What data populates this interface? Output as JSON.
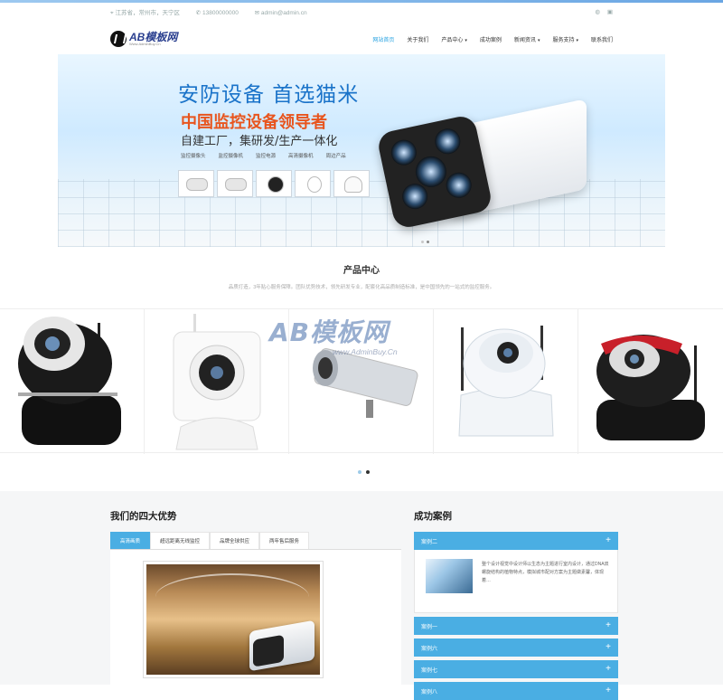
{
  "topbar": {
    "location": "江苏省，常州市，天宁区",
    "phone": "13800000000",
    "email": "admin@admin.cn",
    "icons": [
      "location-icon",
      "phone-icon",
      "mail-icon",
      "weibo-icon",
      "wechat-icon"
    ]
  },
  "nav": {
    "logo_brand": "AB模板网",
    "logo_sub": "Www.AdminBuy.Cn",
    "items": [
      {
        "label": "网站首页",
        "active": true,
        "dropdown": false
      },
      {
        "label": "关于我们",
        "active": false,
        "dropdown": false
      },
      {
        "label": "产品中心",
        "active": false,
        "dropdown": true
      },
      {
        "label": "成功案例",
        "active": false,
        "dropdown": false
      },
      {
        "label": "新闻资讯",
        "active": false,
        "dropdown": true
      },
      {
        "label": "服务支持",
        "active": false,
        "dropdown": true
      },
      {
        "label": "联系我们",
        "active": false,
        "dropdown": false
      }
    ]
  },
  "banner": {
    "headline": "安防设备 首选猫米",
    "subheadline": "中国监控设备领导者",
    "tagline": "自建工厂，集研发/生产一体化",
    "categories": [
      "监控摄像头",
      "监控摄像机",
      "监控电源",
      "高清摄像机",
      "周边产品"
    ]
  },
  "products": {
    "title": "产品中心",
    "desc": "品质打造，3年贴心服务保障。团队优势技术，领先研发专业，配套化高品质制造标准，是中国领先的一站式的监控服务。",
    "watermark": "AB模板网",
    "watermark_sub": "www.AdminBuy.Cn"
  },
  "advantages": {
    "title": "我们的四大优势",
    "tabs": [
      "高清画质",
      "超远距离无线监控",
      "品牌全球供应",
      "两年售后服务"
    ]
  },
  "cases": {
    "title": "成功案例",
    "open_item": "案例二",
    "open_text": "整个设计视觉中设计师以生态为主题进行室内设计，通过DNA双螺旋结构的植物特点，模拟城市配对方案为主题做素馨，体现着…",
    "items": [
      "案例一",
      "案例六",
      "案例七",
      "案例八"
    ]
  },
  "colors": {
    "accent": "#4aaee3",
    "headline_blue": "#1a73c9",
    "headline_orange": "#e8551e"
  }
}
